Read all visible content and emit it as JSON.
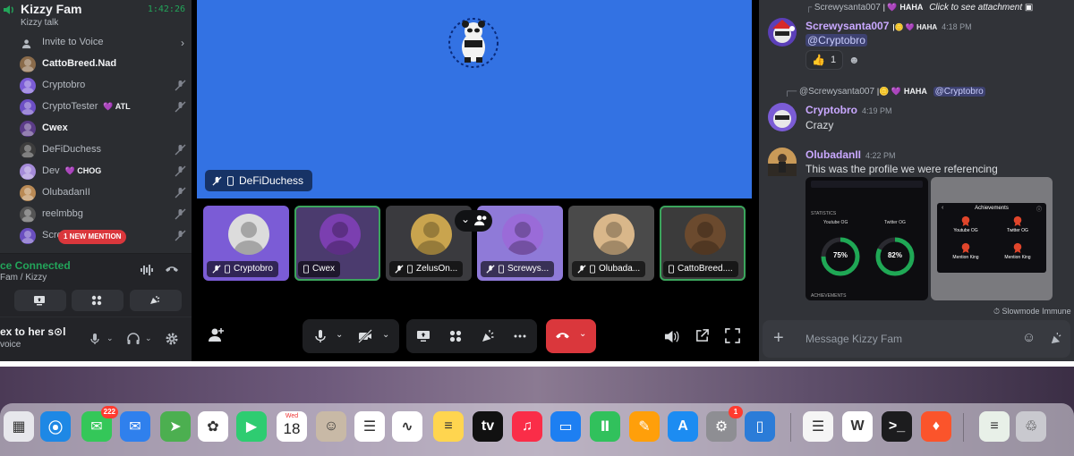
{
  "sidebar": {
    "channel_name": "Kizzy Fam",
    "channel_sub": "Kizzy talk",
    "timer": "1:42:26",
    "invite_label": "Invite to Voice",
    "members": [
      {
        "name": "CattoBreed.Nad",
        "bold": true,
        "tag": "",
        "muted": false,
        "color": "#8a6b4a"
      },
      {
        "name": "Cryptobro",
        "bold": false,
        "tag": "",
        "muted": true,
        "color": "#7b5cd6"
      },
      {
        "name": "CryptoTester",
        "bold": false,
        "tag": "ATL",
        "muted": true,
        "color": "#6d4fc4"
      },
      {
        "name": "Cwex",
        "bold": true,
        "tag": "",
        "muted": false,
        "color": "#5b3c88"
      },
      {
        "name": "DeFiDuchess",
        "bold": false,
        "tag": "",
        "muted": true,
        "color": "#3d3d3d"
      },
      {
        "name": "Dev",
        "bold": false,
        "tag": "CHOG",
        "muted": true,
        "color": "#a58bd9"
      },
      {
        "name": "OlubadanII",
        "bold": false,
        "tag": "",
        "muted": true,
        "color": "#b98a55"
      },
      {
        "name": "reelmbbg",
        "bold": false,
        "tag": "",
        "muted": true,
        "color": "#555"
      },
      {
        "name": "Scre",
        "bold": false,
        "tag": "HAHA",
        "muted": true,
        "color": "#6a4fc0"
      }
    ],
    "mention_pill": "1 NEW MENTION",
    "voice_status": "ce Connected",
    "voice_where": "Fam / Kizzy",
    "user_name": "ex to her s⊙l",
    "user_status": "voice"
  },
  "call": {
    "stage_label": "DeFiDuchess",
    "tiles": [
      {
        "label": "Cryptobro",
        "bg": "#7b5cd6",
        "avatar": "#dcdcdc",
        "speaking": false,
        "muted": true
      },
      {
        "label": "Cwex",
        "bg": "#4b3b6e",
        "avatar": "#7b3fb0",
        "speaking": true,
        "muted": false
      },
      {
        "label": "ZelusOn...",
        "bg": "#3a3a3e",
        "avatar": "#c9a44e",
        "speaking": false,
        "muted": true
      },
      {
        "label": "Screwys...",
        "bg": "#8f7ad8",
        "avatar": "#9a6bd8",
        "speaking": false,
        "muted": true
      },
      {
        "label": "Olubada...",
        "bg": "#4a4a4a",
        "avatar": "#d9b78a",
        "speaking": false,
        "muted": true
      },
      {
        "label": "CattoBreed....",
        "bg": "#3b3b3b",
        "avatar": "#6b4a2e",
        "speaking": true,
        "muted": false
      }
    ]
  },
  "chat": {
    "top_reply": {
      "name": "Screwysanta007",
      "badge": "HAHA",
      "text": "Click to see attachment"
    },
    "msg1": {
      "author": "Screwysanta007",
      "badge": "HAHA",
      "time": "4:18 PM",
      "text": "@Cryptobro",
      "reaction_count": "1"
    },
    "reply2": {
      "name": "@Screwysanta007",
      "badge": "HAHA",
      "mention": "@Cryptobro"
    },
    "msg2": {
      "author": "Cryptobro",
      "time": "4:19 PM",
      "text": "Crazy"
    },
    "msg3": {
      "author": "OlubadanII",
      "time": "4:22 PM",
      "text": "This was the profile we were referencing"
    },
    "attach1": {
      "stat1": "75%",
      "stat2": "82%",
      "h1": "Youtube OG",
      "h2": "Twitter OG",
      "section": "STATISTICS",
      "ach": "ACHIEVEMENTS"
    },
    "attach2": {
      "title": "Achievements",
      "items": [
        "Youtube OG",
        "Twitter OG",
        "Mention King",
        "Mention King"
      ]
    },
    "slowmode": "Slowmode Immune",
    "composer_placeholder": "Message Kizzy Fam"
  },
  "dock": {
    "apps": [
      {
        "name": "launchpad",
        "color": "#e7e7ec",
        "glyph": "▦",
        "badge": ""
      },
      {
        "name": "safari",
        "color": "#1e88e5",
        "glyph": "⦿",
        "badge": ""
      },
      {
        "name": "messages",
        "color": "#34c759",
        "glyph": "✉",
        "badge": "222"
      },
      {
        "name": "mail",
        "color": "#2f80ed",
        "glyph": "✉",
        "badge": ""
      },
      {
        "name": "maps",
        "color": "#4caf50",
        "glyph": "➤",
        "badge": ""
      },
      {
        "name": "photos",
        "color": "#ffffff",
        "glyph": "✿",
        "badge": ""
      },
      {
        "name": "facetime",
        "color": "#2ecc71",
        "glyph": "▶",
        "badge": ""
      },
      {
        "name": "calendar",
        "color": "#ffffff",
        "glyph": "18",
        "badge": ""
      },
      {
        "name": "contacts",
        "color": "#c8b9a6",
        "glyph": "☺",
        "badge": ""
      },
      {
        "name": "reminders",
        "color": "#ffffff",
        "glyph": "☰",
        "badge": ""
      },
      {
        "name": "freeform",
        "color": "#ffffff",
        "glyph": "∿",
        "badge": ""
      },
      {
        "name": "notes",
        "color": "#ffd54f",
        "glyph": "≡",
        "badge": ""
      },
      {
        "name": "appletv",
        "color": "#111111",
        "glyph": "tv",
        "badge": ""
      },
      {
        "name": "music",
        "color": "#fa2d48",
        "glyph": "♫",
        "badge": ""
      },
      {
        "name": "keynote",
        "color": "#1d7ff2",
        "glyph": "▭",
        "badge": ""
      },
      {
        "name": "numbers",
        "color": "#31c15c",
        "glyph": "Ⅱ",
        "badge": ""
      },
      {
        "name": "pages",
        "color": "#ff9f0a",
        "glyph": "✎",
        "badge": ""
      },
      {
        "name": "appstore",
        "color": "#1c8cf2",
        "glyph": "A",
        "badge": ""
      },
      {
        "name": "settings",
        "color": "#8e8e93",
        "glyph": "⚙",
        "badge": "1"
      },
      {
        "name": "simulator",
        "color": "#2b7cd8",
        "glyph": "▯",
        "badge": ""
      },
      {
        "name": "textedit",
        "color": "#f5f5f5",
        "glyph": "☰",
        "badge": ""
      },
      {
        "name": "wps",
        "color": "#ffffff",
        "glyph": "W",
        "badge": ""
      },
      {
        "name": "terminal",
        "color": "#1c1c1e",
        "glyph": ">_",
        "badge": ""
      },
      {
        "name": "brave",
        "color": "#fb542b",
        "glyph": "♦",
        "badge": ""
      },
      {
        "name": "doc-stack",
        "color": "#e8f0e8",
        "glyph": "≡",
        "badge": ""
      },
      {
        "name": "trash",
        "color": "#c9c9cf",
        "glyph": "♲",
        "badge": ""
      }
    ],
    "calendar_day": "Wed",
    "appletv_label": "tv"
  }
}
